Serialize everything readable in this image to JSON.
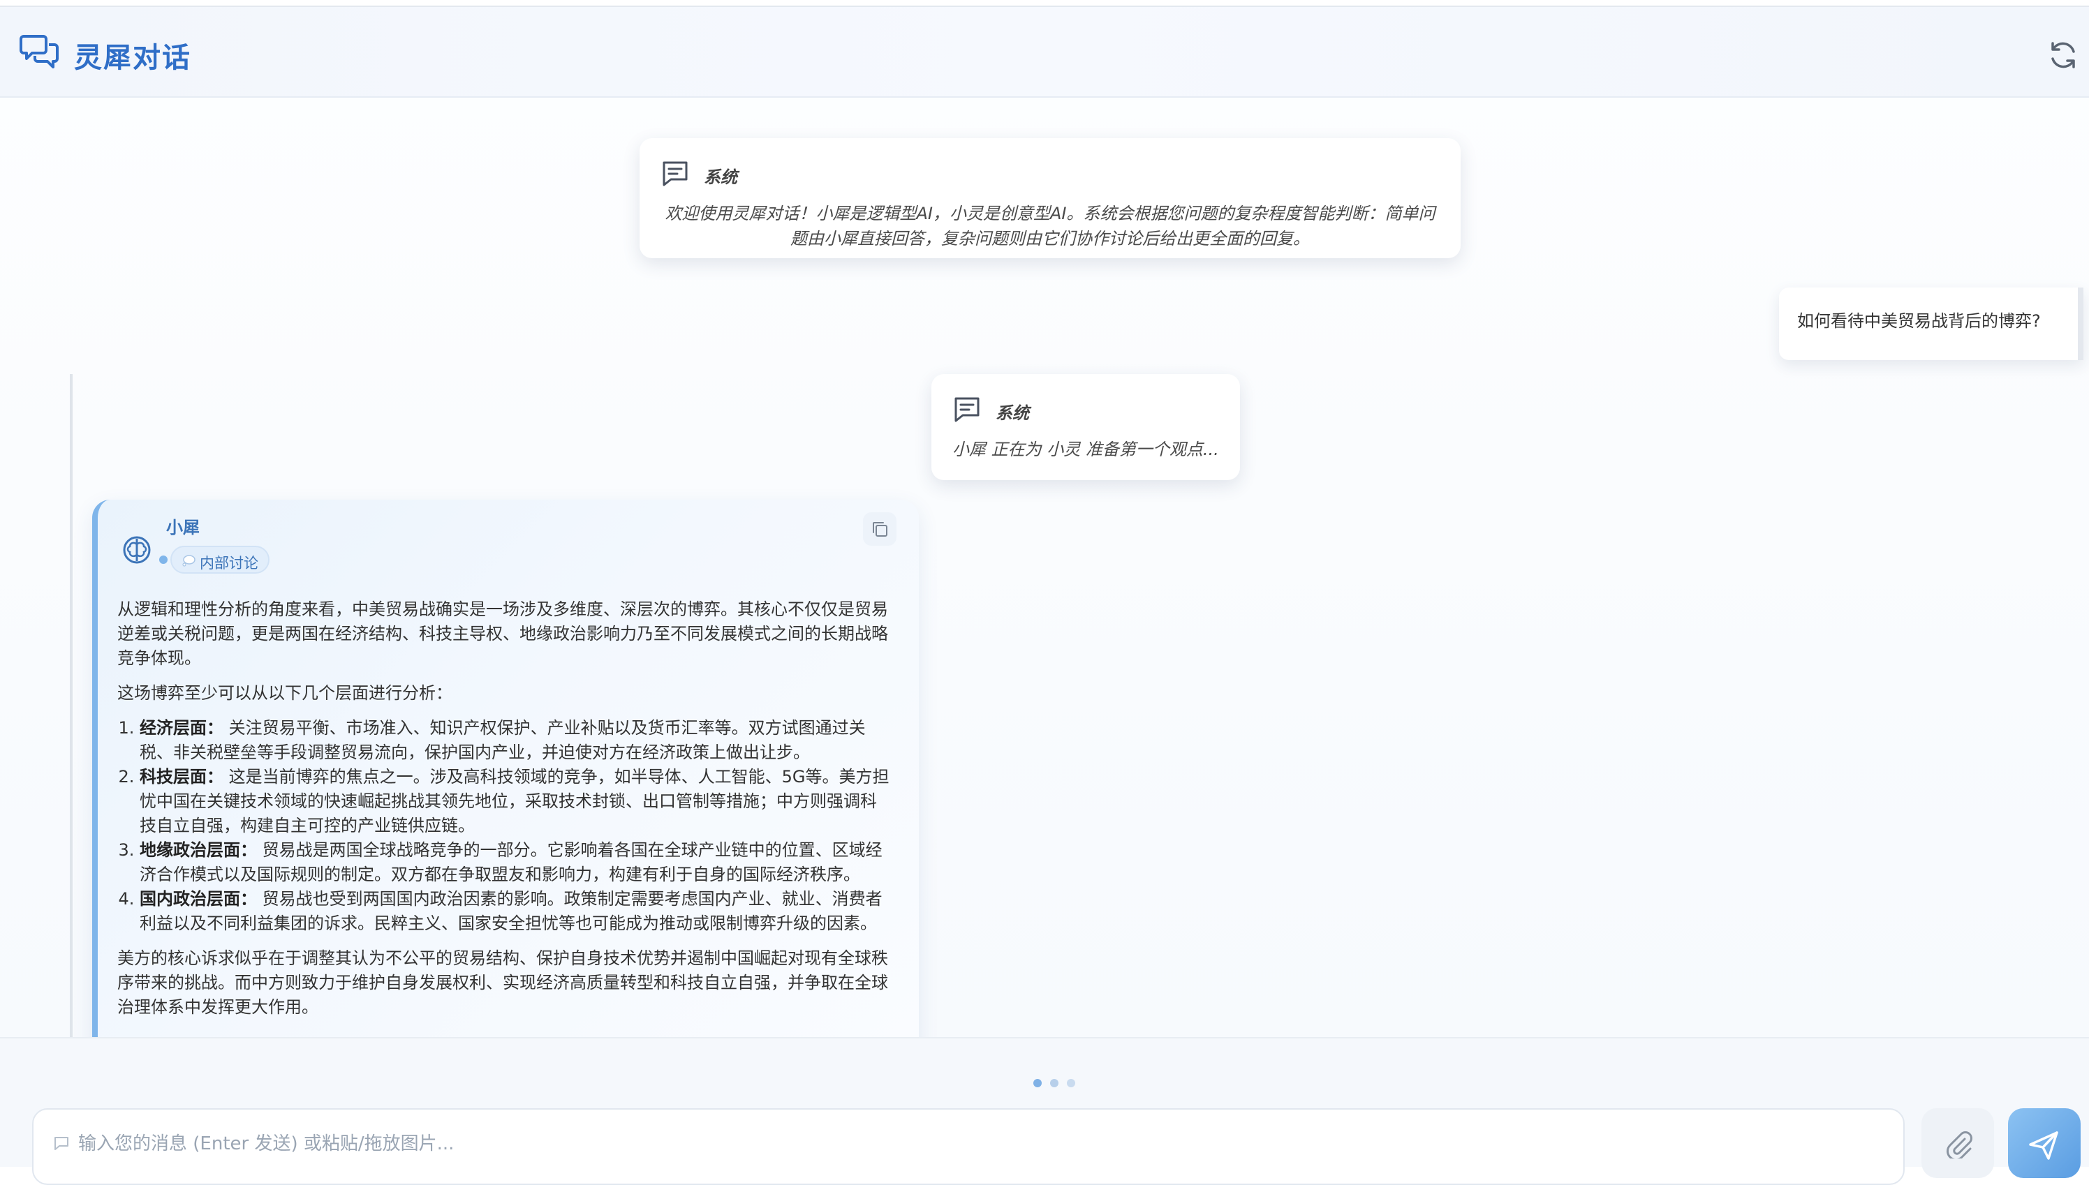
{
  "header": {
    "title": "灵犀对话",
    "logo_icon": "chat-bubbles-icon",
    "refresh_icon": "refresh-icon",
    "accent_color": "#2f6ec7"
  },
  "messages": {
    "system_welcome": {
      "label": "系统",
      "text": "欢迎使用灵犀对话！小犀是逻辑型AI，小灵是创意型AI。系统会根据您问题的复杂程度智能判断：简单问题由小犀直接回答，复杂问题则由它们协作讨论后给出更全面的回复。"
    },
    "user_question": {
      "text": "如何看待中美贸易战背后的博弈?"
    },
    "system_status": {
      "label": "系统",
      "text": "小犀 正在为 小灵 准备第一个观点..."
    },
    "ai_reply": {
      "name": "小犀",
      "tag": "内部讨论",
      "avatar_icon": "brain-icon",
      "paragraph_1": "从逻辑和理性分析的角度来看，中美贸易战确实是一场涉及多维度、深层次的博弈。其核心不仅仅是贸易逆差或关税问题，更是两国在经济结构、科技主导权、地缘政治影响力乃至不同发展模式之间的长期战略竞争体现。",
      "paragraph_2": "这场博弈至少可以从以下几个层面进行分析：",
      "list": [
        {
          "title": "经济层面：",
          "text": " 关注贸易平衡、市场准入、知识产权保护、产业补贴以及货币汇率等。双方试图通过关税、非关税壁垒等手段调整贸易流向，保护国内产业，并迫使对方在经济政策上做出让步。"
        },
        {
          "title": "科技层面：",
          "text": " 这是当前博弈的焦点之一。涉及高科技领域的竞争，如半导体、人工智能、5G等。美方担忧中国在关键技术领域的快速崛起挑战其领先地位，采取技术封锁、出口管制等措施；中方则强调科技自立自强，构建自主可控的产业链供应链。"
        },
        {
          "title": "地缘政治层面：",
          "text": " 贸易战是两国全球战略竞争的一部分。它影响着各国在全球产业链中的位置、区域经济合作模式以及国际规则的制定。双方都在争取盟友和影响力，构建有利于自身的国际经济秩序。"
        },
        {
          "title": "国内政治层面：",
          "text": " 贸易战也受到两国国内政治因素的影响。政策制定需要考虑国内产业、就业、消费者利益以及不同利益集团的诉求。民粹主义、国家安全担忧等也可能成为推动或限制博弈升级的因素。"
        }
      ],
      "paragraph_3": "美方的核心诉求似乎在于调整其认为不公平的贸易结构、保护自身技术优势并遏制中国崛起对现有全球秩序带来的挑战。而中方则致力于维护自身发展权利、实现经济高质量转型和科技自立自强，并争取在全球治理体系中发挥更大作用。"
    }
  },
  "input": {
    "placeholder": "输入您的消息 (Enter 发送) 或粘贴/拖放图片...",
    "value": "",
    "attach_icon": "paperclip-icon",
    "send_icon": "send-icon"
  }
}
